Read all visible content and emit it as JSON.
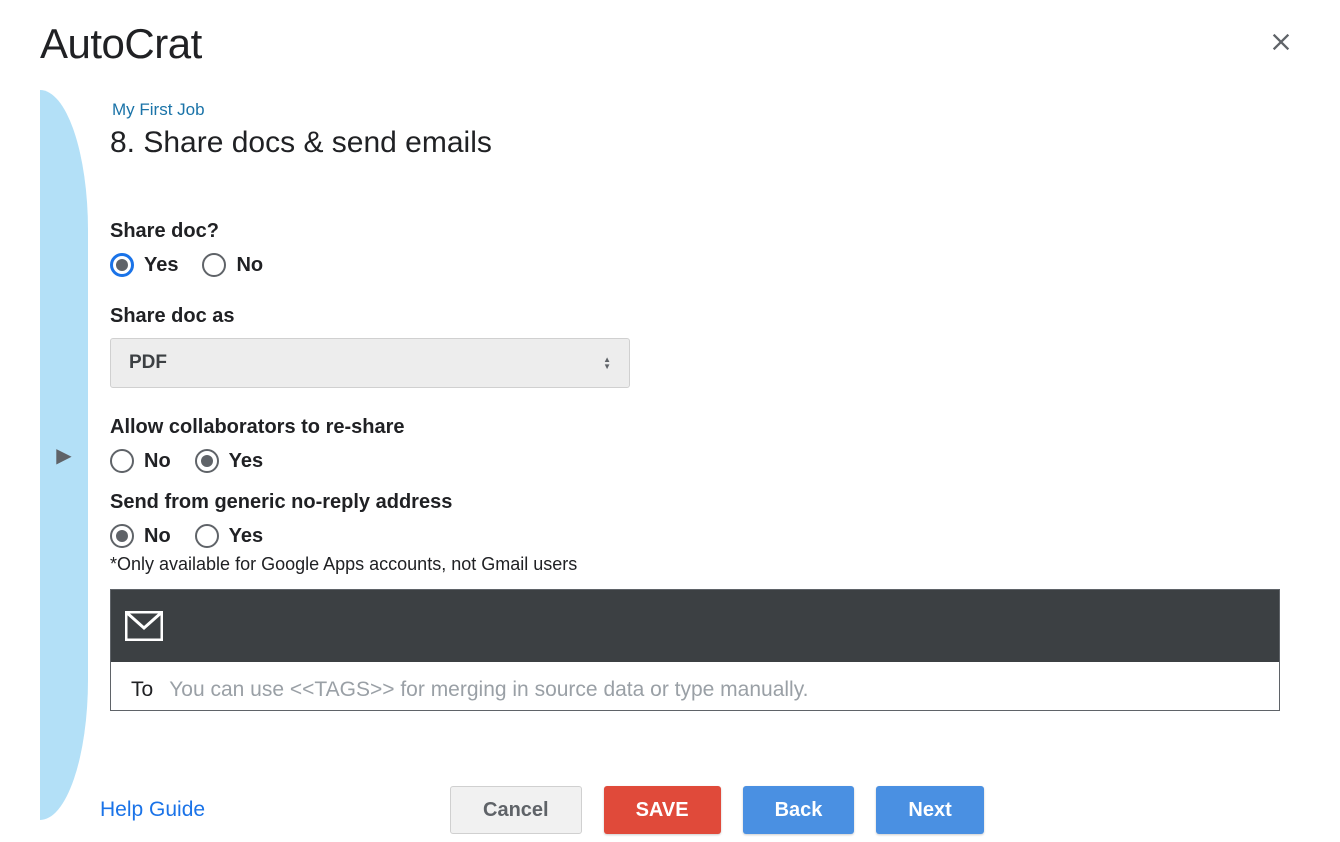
{
  "header": {
    "app_title": "AutoCrat"
  },
  "breadcrumb": "My First Job",
  "step_title": "8. Share docs & send emails",
  "form": {
    "share_doc": {
      "label": "Share doc?",
      "options": {
        "yes": "Yes",
        "no": "No"
      },
      "selected": "yes"
    },
    "share_doc_as": {
      "label": "Share doc as",
      "value": "PDF"
    },
    "allow_reshare": {
      "label": "Allow collaborators to re-share",
      "options": {
        "no": "No",
        "yes": "Yes"
      },
      "selected": "yes"
    },
    "generic_noreply": {
      "label": "Send from generic no-reply address",
      "options": {
        "no": "No",
        "yes": "Yes"
      },
      "selected": "no",
      "hint": "*Only available for Google Apps accounts, not Gmail users"
    },
    "email": {
      "to_label": "To",
      "to_placeholder": "You can use <<TAGS>> for merging in source data or type manually."
    }
  },
  "footer": {
    "help": "Help Guide",
    "buttons": {
      "cancel": "Cancel",
      "save": "SAVE",
      "back": "Back",
      "next": "Next"
    }
  }
}
